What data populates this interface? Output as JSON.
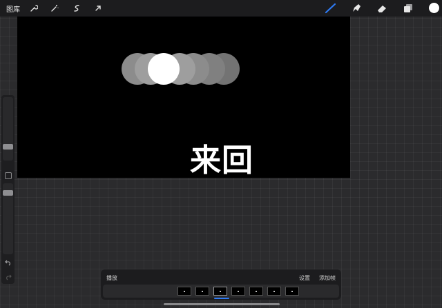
{
  "toolbar": {
    "gallery_label": "图库",
    "left_tools": [
      "wrench-icon",
      "magic-wand-icon",
      "selection-icon",
      "transform-arrow-icon"
    ],
    "right_tools": [
      "brush-icon",
      "smudge-icon",
      "eraser-icon",
      "layers-icon"
    ],
    "accent_color": "#2e7bf6",
    "current_color": "#ffffff"
  },
  "canvas": {
    "background": "#000000",
    "text": "来回",
    "circle_opacities": [
      0.55,
      0.62,
      1.0,
      0.62,
      0.55,
      0.5,
      0.45
    ]
  },
  "sidebar": {
    "brush_size_level": 0.55,
    "opacity_level": 0.1
  },
  "timeline": {
    "play_label": "播放",
    "settings_label": "设置",
    "add_frame_label": "添加帧",
    "frame_count": 7,
    "selected_frame": 3
  }
}
